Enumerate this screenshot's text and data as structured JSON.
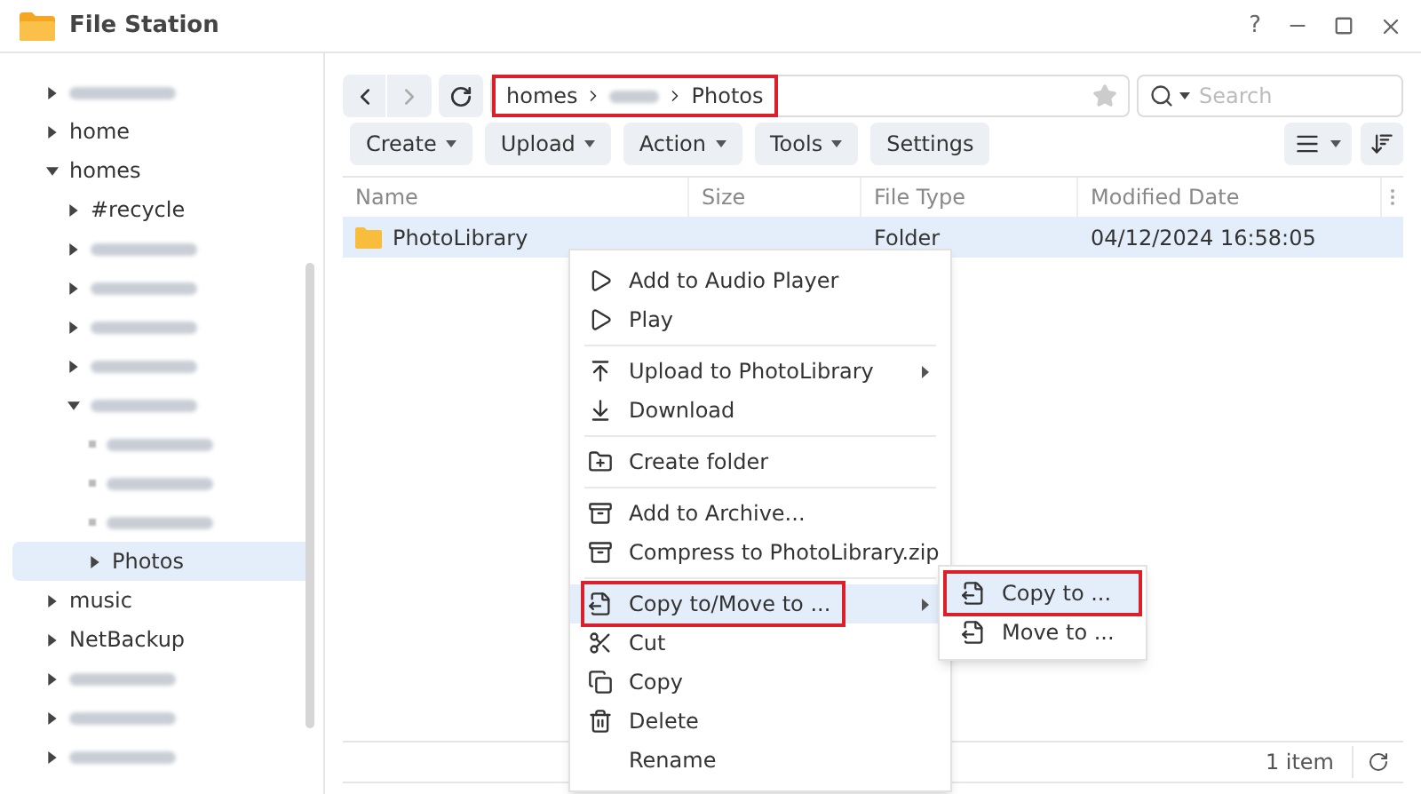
{
  "window": {
    "title": "File Station",
    "help": "?"
  },
  "tree": [
    {
      "kind": "redacted",
      "expanded": false,
      "selected": false
    },
    {
      "kind": "folder",
      "label": "home",
      "expanded": false,
      "selected": false
    },
    {
      "kind": "folder",
      "label": "homes",
      "expanded": true,
      "selected": false,
      "children": [
        {
          "kind": "folder",
          "label": "#recycle",
          "expanded": false,
          "selected": false
        },
        {
          "kind": "redacted",
          "expanded": false,
          "selected": false
        },
        {
          "kind": "redacted",
          "expanded": false,
          "selected": false
        },
        {
          "kind": "redacted",
          "expanded": false,
          "selected": false
        },
        {
          "kind": "redacted",
          "expanded": false,
          "selected": false
        },
        {
          "kind": "redacted",
          "expanded": true,
          "selected": false,
          "children": [
            {
              "kind": "redacted-leaf",
              "selected": false
            },
            {
              "kind": "redacted-leaf",
              "selected": false
            },
            {
              "kind": "redacted-leaf",
              "selected": false
            },
            {
              "kind": "folder",
              "label": "Photos",
              "expanded": false,
              "selected": true
            }
          ]
        }
      ]
    },
    {
      "kind": "folder",
      "label": "music",
      "expanded": false,
      "selected": false
    },
    {
      "kind": "folder",
      "label": "NetBackup",
      "expanded": false,
      "selected": false
    },
    {
      "kind": "redacted",
      "expanded": false,
      "selected": false
    },
    {
      "kind": "redacted",
      "expanded": false,
      "selected": false
    },
    {
      "kind": "redacted",
      "expanded": false,
      "selected": false
    }
  ],
  "path": {
    "segments": [
      {
        "kind": "text",
        "label": "homes"
      },
      {
        "kind": "redacted"
      },
      {
        "kind": "text",
        "label": "Photos"
      }
    ],
    "annotated": true
  },
  "search": {
    "placeholder": "Search"
  },
  "toolbar": [
    {
      "label": "Create",
      "has_dropdown": true
    },
    {
      "label": "Upload",
      "has_dropdown": true
    },
    {
      "label": "Action",
      "has_dropdown": true
    },
    {
      "label": "Tools",
      "has_dropdown": true
    },
    {
      "label": "Settings",
      "has_dropdown": false
    }
  ],
  "table": {
    "columns": [
      "Name",
      "Size",
      "File Type",
      "Modified Date"
    ],
    "rows": [
      {
        "name": "PhotoLibrary",
        "size": "",
        "type": "Folder",
        "modified": "04/12/2024 16:58:05",
        "selected": true
      }
    ]
  },
  "context_menu": [
    {
      "kind": "item",
      "label": "Add to Audio Player",
      "highlighted": false,
      "has_submenu": false,
      "annotated": false
    },
    {
      "kind": "item",
      "label": "Play",
      "highlighted": false,
      "has_submenu": false,
      "annotated": false
    },
    {
      "kind": "separator"
    },
    {
      "kind": "item",
      "label": "Upload to PhotoLibrary",
      "highlighted": false,
      "has_submenu": true,
      "annotated": false
    },
    {
      "kind": "item",
      "label": "Download",
      "highlighted": false,
      "has_submenu": false,
      "annotated": false
    },
    {
      "kind": "separator"
    },
    {
      "kind": "item",
      "label": "Create folder",
      "highlighted": false,
      "has_submenu": false,
      "annotated": false
    },
    {
      "kind": "separator"
    },
    {
      "kind": "item",
      "label": "Add to Archive...",
      "highlighted": false,
      "has_submenu": false,
      "annotated": false
    },
    {
      "kind": "item",
      "label": "Compress to PhotoLibrary.zip",
      "highlighted": false,
      "has_submenu": false,
      "annotated": false
    },
    {
      "kind": "separator"
    },
    {
      "kind": "item",
      "label": "Copy to/Move to ...",
      "highlighted": true,
      "has_submenu": true,
      "annotated": true
    },
    {
      "kind": "item",
      "label": "Cut",
      "highlighted": false,
      "has_submenu": false,
      "annotated": false
    },
    {
      "kind": "item",
      "label": "Copy",
      "highlighted": false,
      "has_submenu": false,
      "annotated": false
    },
    {
      "kind": "item",
      "label": "Delete",
      "highlighted": false,
      "has_submenu": false,
      "annotated": false
    },
    {
      "kind": "item",
      "label": "Rename",
      "highlighted": false,
      "has_submenu": false,
      "annotated": false
    }
  ],
  "submenu": [
    {
      "label": "Copy to ...",
      "highlighted": true,
      "annotated": true
    },
    {
      "label": "Move to ...",
      "highlighted": false,
      "annotated": false
    }
  ],
  "status_bar": {
    "count": "1 item"
  }
}
